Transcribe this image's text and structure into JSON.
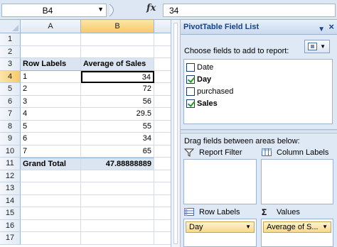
{
  "formula_bar": {
    "name_box": "B4",
    "fx_label": "fx",
    "value": "34"
  },
  "sheet": {
    "columns": [
      "A",
      "B"
    ],
    "row_numbers": [
      "1",
      "2",
      "3",
      "4",
      "5",
      "6",
      "7",
      "8",
      "9",
      "10",
      "11",
      "12",
      "13",
      "14",
      "15",
      "16",
      "17"
    ],
    "pivot": {
      "header": {
        "row_labels": "Row Labels",
        "value": "Average of Sales"
      },
      "rows": [
        {
          "label": "1",
          "value": "34"
        },
        {
          "label": "2",
          "value": "72"
        },
        {
          "label": "3",
          "value": "56"
        },
        {
          "label": "4",
          "value": "29.5"
        },
        {
          "label": "5",
          "value": "55"
        },
        {
          "label": "6",
          "value": "34"
        },
        {
          "label": "7",
          "value": "65"
        }
      ],
      "grand_total": {
        "label": "Grand Total",
        "value": "47.88888889"
      }
    }
  },
  "pane": {
    "title": "PivotTable Field List",
    "choose_label": "Choose fields to add to report:",
    "fields": [
      {
        "label": "Date",
        "checked": false
      },
      {
        "label": "Day",
        "checked": true
      },
      {
        "label": "purchased",
        "checked": false
      },
      {
        "label": "Sales",
        "checked": true
      }
    ],
    "drag_label": "Drag fields between areas below:",
    "areas": {
      "report_filter": "Report Filter",
      "column_labels": "Column Labels",
      "row_labels": "Row Labels",
      "values": "Values"
    },
    "row_label_chip": "Day",
    "values_chip": "Average of S..."
  }
}
